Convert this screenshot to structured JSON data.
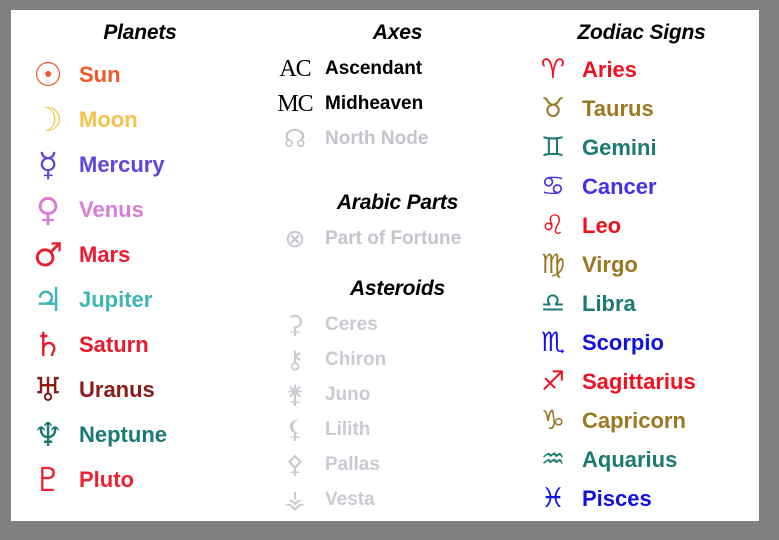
{
  "card": {
    "background": "#ffffff",
    "border_color": "#808080"
  },
  "columns": {
    "planets": {
      "title": "Planets",
      "items": [
        {
          "glyph": "☉",
          "label": "Sun",
          "color": "#F0592A"
        },
        {
          "glyph": "☽",
          "label": "Moon",
          "color": "#F5C14B"
        },
        {
          "glyph": "☿",
          "label": "Mercury",
          "color": "#6245DE"
        },
        {
          "glyph": "♀",
          "label": "Venus",
          "color": "#D87CD6"
        },
        {
          "glyph": "♂",
          "label": "Mars",
          "color": "#ED1B2E"
        },
        {
          "glyph": "♃",
          "label": "Jupiter",
          "color": "#3EB5B3"
        },
        {
          "glyph": "♄",
          "label": "Saturn",
          "color": "#E8192C"
        },
        {
          "glyph": "♅",
          "label": "Uranus",
          "color": "#8B1A18"
        },
        {
          "glyph": "♆",
          "label": "Neptune",
          "color": "#1C7A76"
        },
        {
          "glyph": "♇",
          "label": "Pluto",
          "color": "#EE2233"
        }
      ]
    },
    "axes": {
      "title": "Axes",
      "items": [
        {
          "glyph": "AC",
          "label": "Ascendant",
          "color": "#000000",
          "serif": true,
          "dim": false
        },
        {
          "glyph": "MC",
          "label": "Midheaven",
          "color": "#000000",
          "serif": true,
          "dim": false
        },
        {
          "glyph": "☊",
          "label": "North Node",
          "color": "#C2C5CC",
          "serif": false,
          "dim": true
        }
      ]
    },
    "arabic_parts": {
      "title": "Arabic Parts",
      "items": [
        {
          "glyph": "⊗",
          "label": "Part of Fortune",
          "color": "#C2C5CC",
          "serif": false,
          "dim": true
        }
      ]
    },
    "asteroids": {
      "title": "Asteroids",
      "items": [
        {
          "glyph": "⚳",
          "label": "Ceres",
          "color": "#C8CBD1",
          "serif": false,
          "dim": true
        },
        {
          "glyph": "⚷",
          "label": "Chiron",
          "color": "#C8CBD1",
          "serif": false,
          "dim": true
        },
        {
          "glyph": "⚵",
          "label": "Juno",
          "color": "#C8CBD1",
          "serif": false,
          "dim": true
        },
        {
          "glyph": "⚸",
          "label": "Lilith",
          "color": "#C8CBD1",
          "serif": false,
          "dim": true
        },
        {
          "glyph": "⚴",
          "label": "Pallas",
          "color": "#C8CBD1",
          "serif": false,
          "dim": true
        },
        {
          "glyph": "⚶",
          "label": "Vesta",
          "color": "#C8CBD1",
          "serif": false,
          "dim": true
        }
      ]
    },
    "zodiac": {
      "title": "Zodiac Signs",
      "items": [
        {
          "glyph": "♈",
          "label": "Aries",
          "color": "#F0101F"
        },
        {
          "glyph": "♉",
          "label": "Taurus",
          "color": "#9B7722"
        },
        {
          "glyph": "♊",
          "label": "Gemini",
          "color": "#1B7A73"
        },
        {
          "glyph": "♋",
          "label": "Cancer",
          "color": "#4530E8"
        },
        {
          "glyph": "♌",
          "label": "Leo",
          "color": "#F0101F"
        },
        {
          "glyph": "♍",
          "label": "Virgo",
          "color": "#9B7722"
        },
        {
          "glyph": "♎",
          "label": "Libra",
          "color": "#1B7A73"
        },
        {
          "glyph": "♏",
          "label": "Scorpio",
          "color": "#1010E0"
        },
        {
          "glyph": "♐",
          "label": "Sagittarius",
          "color": "#F0101F"
        },
        {
          "glyph": "♑",
          "label": "Capricorn",
          "color": "#9B7722"
        },
        {
          "glyph": "♒",
          "label": "Aquarius",
          "color": "#1B7A73"
        },
        {
          "glyph": "♓",
          "label": "Pisces",
          "color": "#1010E0"
        }
      ]
    }
  }
}
